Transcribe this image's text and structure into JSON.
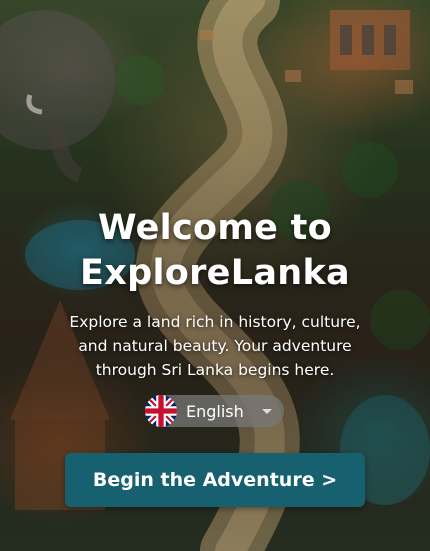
{
  "welcome": {
    "title_line1": "Welcome to",
    "title_line2": "ExploreLanka",
    "subtitle": "Explore a land rich in history, culture, and natural beauty. Your adventure through Sri Lanka begins here."
  },
  "language_selector": {
    "selected": "English",
    "flag_icon": "uk-flag-icon",
    "dropdown_icon": "caret-down-icon"
  },
  "cta": {
    "label": "Begin the Adventure >"
  },
  "colors": {
    "cta_background": "#17606f",
    "text": "#ffffff",
    "selector_background": "#787878"
  }
}
